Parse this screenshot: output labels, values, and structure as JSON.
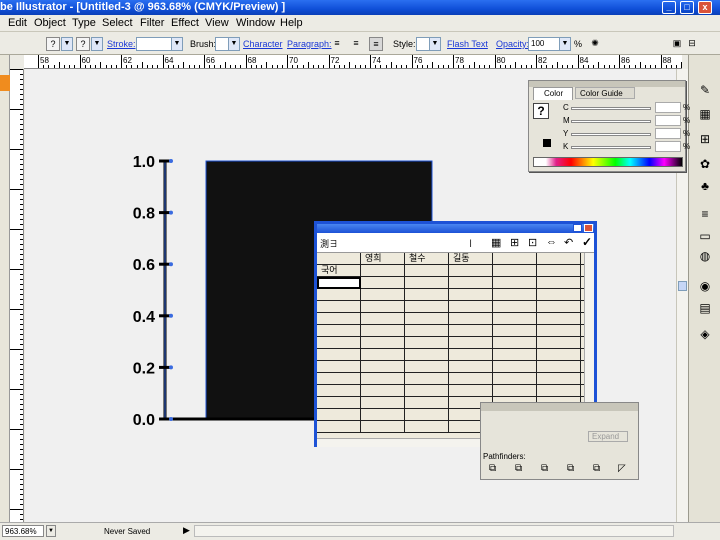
{
  "window": {
    "title": "be Illustrator - [Untitled-3 @ 963.68% (CMYK/Preview) ]",
    "min": "_",
    "max": "□",
    "close": "x"
  },
  "menu": [
    "Edit",
    "Object",
    "Type",
    "Select",
    "Filter",
    "Effect",
    "View",
    "Window",
    "Help"
  ],
  "controlbar": {
    "stroke": "Stroke:",
    "brush": "Brush:",
    "character": "Character",
    "paragraph": "Paragraph:",
    "style": "Style:",
    "flash_text": "Flash Text",
    "opacity": "Opacity:",
    "opacity_value": "100",
    "opacity_unit": "%"
  },
  "ruler_labels": [
    "58",
    "60",
    "62",
    "64",
    "66",
    "68",
    "70",
    "72",
    "74",
    "76",
    "78",
    "80",
    "82",
    "84",
    "86",
    "88"
  ],
  "graph": {
    "y_labels": [
      "1.0",
      "0.8",
      "0.6",
      "0.4",
      "0.2",
      "0.0"
    ],
    "value": 1.0
  },
  "color_panel": {
    "tab_color": "Color",
    "tab_guide": "Color Guide",
    "channels": [
      "C",
      "M",
      "Y",
      "K"
    ],
    "pct": "%"
  },
  "graph_window": {
    "input_value": "測∃",
    "headers": [
      "",
      "영희",
      "철수",
      "길동",
      "",
      "",
      ""
    ],
    "rows": [
      [
        "국어",
        "",
        "",
        "",
        "",
        "",
        ""
      ]
    ]
  },
  "pathfinder": {
    "expand": "Expand",
    "label": "Pathfinders:"
  },
  "status": {
    "zoom": "963.68%",
    "saved": "Never Saved"
  }
}
